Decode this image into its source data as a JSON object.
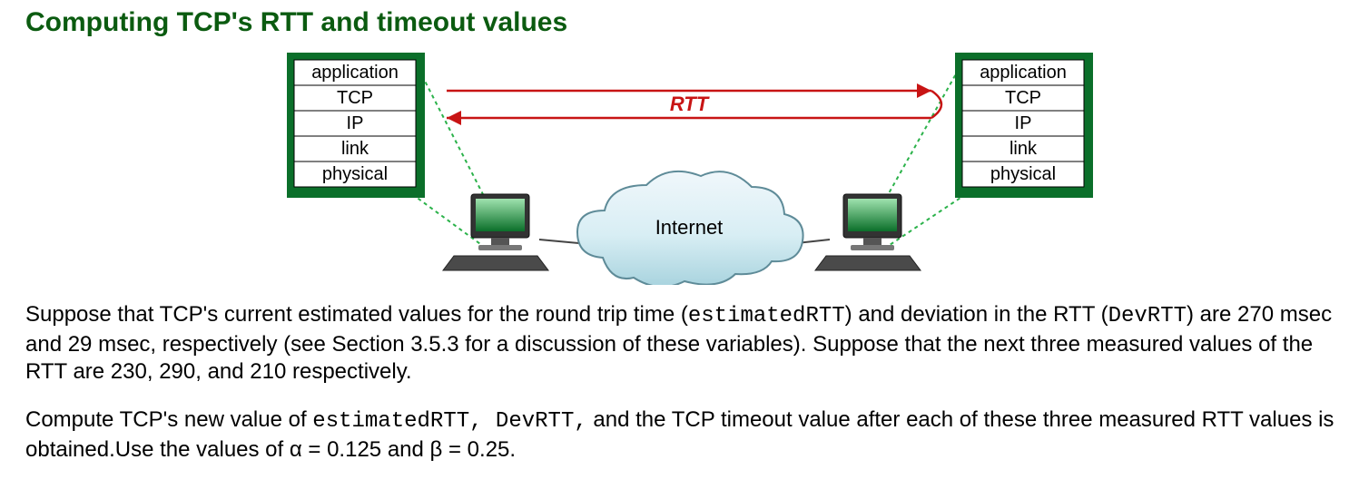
{
  "heading": "Computing TCP's RTT and timeout values",
  "diagram": {
    "layers": [
      "application",
      "TCP",
      "IP",
      "link",
      "physical"
    ],
    "rtt_label": "RTT",
    "internet_label": "Internet"
  },
  "problem": {
    "estimatedRTT_msec": 270,
    "devRTT_msec": 29,
    "section_ref": "Section 3.5.3",
    "measured_rtts": [
      230,
      290,
      210
    ],
    "alpha": 0.125,
    "beta": 0.25
  },
  "text": {
    "p1_a": "Suppose that TCP's current estimated values for the round trip time (",
    "p1_code1": "estimatedRTT",
    "p1_b": ") and deviation in the RTT (",
    "p1_code2": "DevRTT",
    "p1_c": ") are 270 msec and 29 msec, respectively (see Section 3.5.3 for a discussion of these variables). Suppose that the next three measured values of the RTT are 230, 290, and 210 respectively.",
    "p2_a": "Compute TCP's new value of ",
    "p2_code1": "estimatedRTT,  DevRTT,",
    "p2_b": " and the TCP timeout value after each of these three measured RTT values is obtained.Use the values of α = 0.125 and β = 0.25."
  }
}
